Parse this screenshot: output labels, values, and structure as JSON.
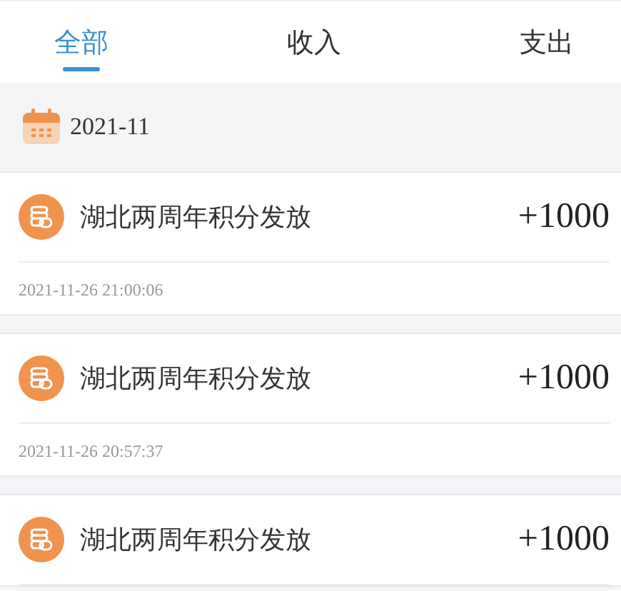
{
  "tabs": [
    {
      "label": "全部",
      "selected": true
    },
    {
      "label": "收入",
      "selected": false
    },
    {
      "label": "支出",
      "selected": false
    }
  ],
  "month": "2021-11",
  "records": [
    {
      "title": "湖北两周年积分发放",
      "amount": "+1000",
      "time": "2021-11-26 21:00:06"
    },
    {
      "title": "湖北两周年积分发放",
      "amount": "+1000",
      "time": "2021-11-26 20:57:37"
    },
    {
      "title": "湖北两周年积分发放",
      "amount": "+1000"
    }
  ]
}
